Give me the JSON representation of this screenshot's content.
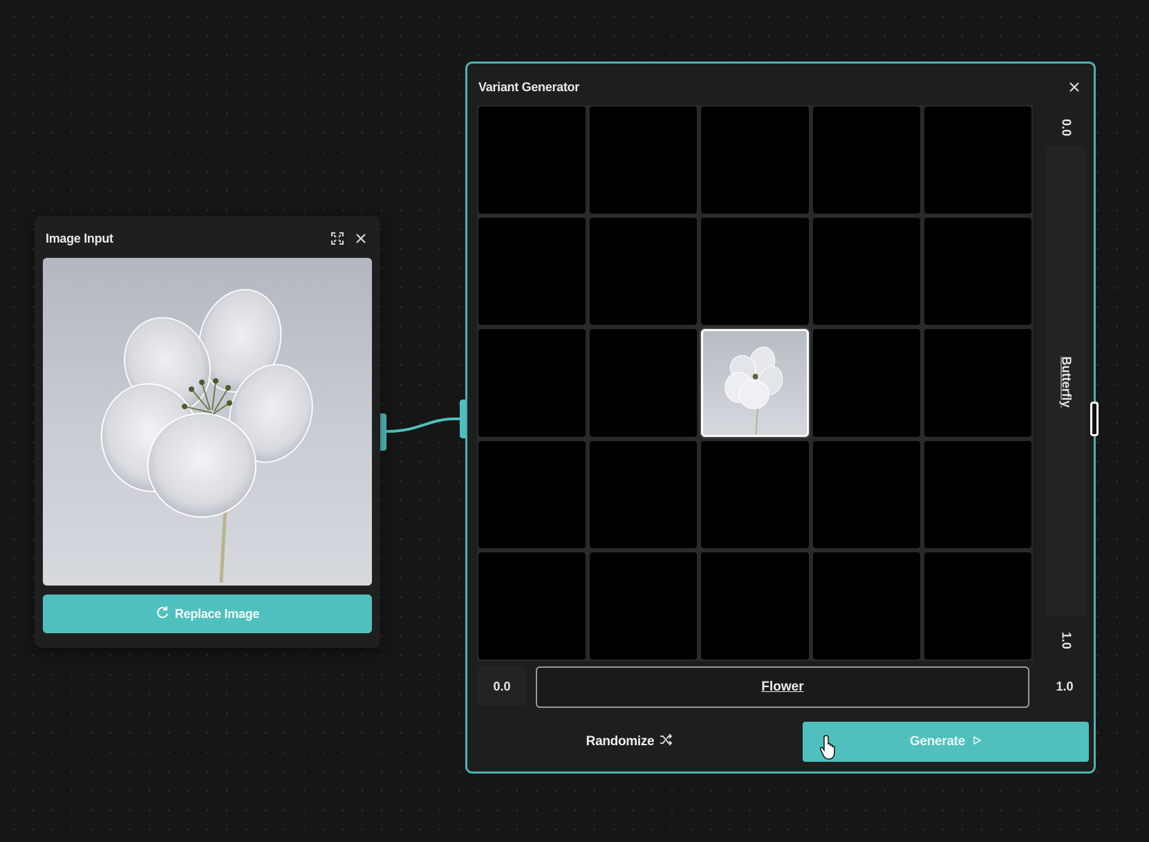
{
  "image_input": {
    "title": "Image Input",
    "expand_icon": "expand-icon",
    "close_icon": "close-icon",
    "preview_alt": "flower",
    "replace_label": "Replace Image",
    "replace_icon": "refresh-icon"
  },
  "variant_generator": {
    "title": "Variant Generator",
    "close_icon": "close-icon",
    "grid": {
      "rows": 5,
      "cols": 5,
      "selected_cell": [
        2,
        2
      ]
    },
    "vertical_axis": {
      "min": "0.0",
      "max": "1.0",
      "label": "Butterfly"
    },
    "horizontal_axis": {
      "min": "0.0",
      "max": "1.0",
      "label": "Flower"
    },
    "randomize_label": "Randomize",
    "randomize_icon": "shuffle-icon",
    "generate_label": "Generate",
    "generate_icon": "play-icon"
  },
  "colors": {
    "accent": "#4fc0bd",
    "node_border": "#49b3b0",
    "background": "#161616"
  }
}
